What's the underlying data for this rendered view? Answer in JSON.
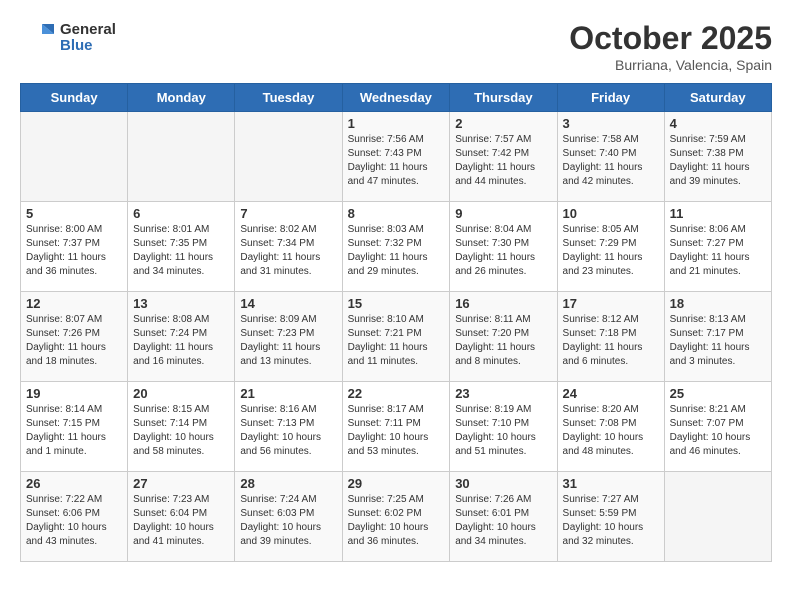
{
  "logo": {
    "line1": "General",
    "line2": "Blue"
  },
  "title": "October 2025",
  "subtitle": "Burriana, Valencia, Spain",
  "days_of_week": [
    "Sunday",
    "Monday",
    "Tuesday",
    "Wednesday",
    "Thursday",
    "Friday",
    "Saturday"
  ],
  "weeks": [
    [
      {
        "num": "",
        "detail": ""
      },
      {
        "num": "",
        "detail": ""
      },
      {
        "num": "",
        "detail": ""
      },
      {
        "num": "1",
        "detail": "Sunrise: 7:56 AM\nSunset: 7:43 PM\nDaylight: 11 hours and 47 minutes."
      },
      {
        "num": "2",
        "detail": "Sunrise: 7:57 AM\nSunset: 7:42 PM\nDaylight: 11 hours and 44 minutes."
      },
      {
        "num": "3",
        "detail": "Sunrise: 7:58 AM\nSunset: 7:40 PM\nDaylight: 11 hours and 42 minutes."
      },
      {
        "num": "4",
        "detail": "Sunrise: 7:59 AM\nSunset: 7:38 PM\nDaylight: 11 hours and 39 minutes."
      }
    ],
    [
      {
        "num": "5",
        "detail": "Sunrise: 8:00 AM\nSunset: 7:37 PM\nDaylight: 11 hours and 36 minutes."
      },
      {
        "num": "6",
        "detail": "Sunrise: 8:01 AM\nSunset: 7:35 PM\nDaylight: 11 hours and 34 minutes."
      },
      {
        "num": "7",
        "detail": "Sunrise: 8:02 AM\nSunset: 7:34 PM\nDaylight: 11 hours and 31 minutes."
      },
      {
        "num": "8",
        "detail": "Sunrise: 8:03 AM\nSunset: 7:32 PM\nDaylight: 11 hours and 29 minutes."
      },
      {
        "num": "9",
        "detail": "Sunrise: 8:04 AM\nSunset: 7:30 PM\nDaylight: 11 hours and 26 minutes."
      },
      {
        "num": "10",
        "detail": "Sunrise: 8:05 AM\nSunset: 7:29 PM\nDaylight: 11 hours and 23 minutes."
      },
      {
        "num": "11",
        "detail": "Sunrise: 8:06 AM\nSunset: 7:27 PM\nDaylight: 11 hours and 21 minutes."
      }
    ],
    [
      {
        "num": "12",
        "detail": "Sunrise: 8:07 AM\nSunset: 7:26 PM\nDaylight: 11 hours and 18 minutes."
      },
      {
        "num": "13",
        "detail": "Sunrise: 8:08 AM\nSunset: 7:24 PM\nDaylight: 11 hours and 16 minutes."
      },
      {
        "num": "14",
        "detail": "Sunrise: 8:09 AM\nSunset: 7:23 PM\nDaylight: 11 hours and 13 minutes."
      },
      {
        "num": "15",
        "detail": "Sunrise: 8:10 AM\nSunset: 7:21 PM\nDaylight: 11 hours and 11 minutes."
      },
      {
        "num": "16",
        "detail": "Sunrise: 8:11 AM\nSunset: 7:20 PM\nDaylight: 11 hours and 8 minutes."
      },
      {
        "num": "17",
        "detail": "Sunrise: 8:12 AM\nSunset: 7:18 PM\nDaylight: 11 hours and 6 minutes."
      },
      {
        "num": "18",
        "detail": "Sunrise: 8:13 AM\nSunset: 7:17 PM\nDaylight: 11 hours and 3 minutes."
      }
    ],
    [
      {
        "num": "19",
        "detail": "Sunrise: 8:14 AM\nSunset: 7:15 PM\nDaylight: 11 hours and 1 minute."
      },
      {
        "num": "20",
        "detail": "Sunrise: 8:15 AM\nSunset: 7:14 PM\nDaylight: 10 hours and 58 minutes."
      },
      {
        "num": "21",
        "detail": "Sunrise: 8:16 AM\nSunset: 7:13 PM\nDaylight: 10 hours and 56 minutes."
      },
      {
        "num": "22",
        "detail": "Sunrise: 8:17 AM\nSunset: 7:11 PM\nDaylight: 10 hours and 53 minutes."
      },
      {
        "num": "23",
        "detail": "Sunrise: 8:19 AM\nSunset: 7:10 PM\nDaylight: 10 hours and 51 minutes."
      },
      {
        "num": "24",
        "detail": "Sunrise: 8:20 AM\nSunset: 7:08 PM\nDaylight: 10 hours and 48 minutes."
      },
      {
        "num": "25",
        "detail": "Sunrise: 8:21 AM\nSunset: 7:07 PM\nDaylight: 10 hours and 46 minutes."
      }
    ],
    [
      {
        "num": "26",
        "detail": "Sunrise: 7:22 AM\nSunset: 6:06 PM\nDaylight: 10 hours and 43 minutes."
      },
      {
        "num": "27",
        "detail": "Sunrise: 7:23 AM\nSunset: 6:04 PM\nDaylight: 10 hours and 41 minutes."
      },
      {
        "num": "28",
        "detail": "Sunrise: 7:24 AM\nSunset: 6:03 PM\nDaylight: 10 hours and 39 minutes."
      },
      {
        "num": "29",
        "detail": "Sunrise: 7:25 AM\nSunset: 6:02 PM\nDaylight: 10 hours and 36 minutes."
      },
      {
        "num": "30",
        "detail": "Sunrise: 7:26 AM\nSunset: 6:01 PM\nDaylight: 10 hours and 34 minutes."
      },
      {
        "num": "31",
        "detail": "Sunrise: 7:27 AM\nSunset: 5:59 PM\nDaylight: 10 hours and 32 minutes."
      },
      {
        "num": "",
        "detail": ""
      }
    ]
  ]
}
